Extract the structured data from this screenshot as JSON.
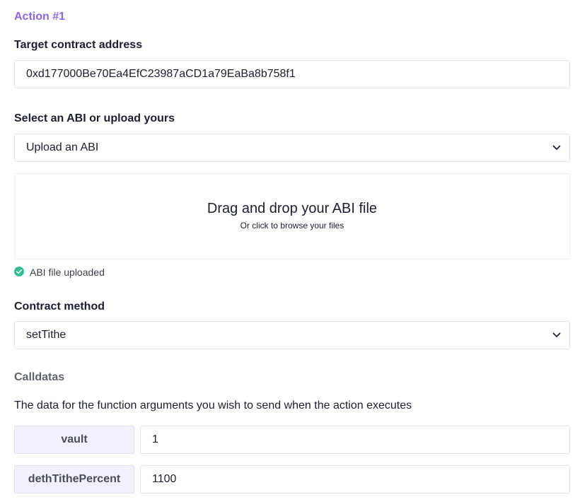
{
  "action": {
    "title": "Action #1"
  },
  "target": {
    "label": "Target contract address",
    "value": "0xd177000Be70Ea4EfC23987aCD1a79EaBa8b758f1"
  },
  "abi_select": {
    "label": "Select an ABI or upload yours",
    "selected": "Upload an ABI"
  },
  "dropzone": {
    "title": "Drag and drop your ABI file",
    "subtitle": "Or click to browse your files"
  },
  "upload_status": {
    "text": "ABI file uploaded",
    "color": "#2fbf8f"
  },
  "method": {
    "label": "Contract method",
    "selected": "setTithe"
  },
  "calldatas": {
    "title": "Calldatas",
    "description": "The data for the function arguments you wish to send when the action executes",
    "args": [
      {
        "name": "vault",
        "value": "1"
      },
      {
        "name": "dethTithePercent",
        "value": "1100"
      }
    ]
  },
  "colors": {
    "accent": "#8b63f0",
    "arg_bg": "#f3f0fd"
  }
}
